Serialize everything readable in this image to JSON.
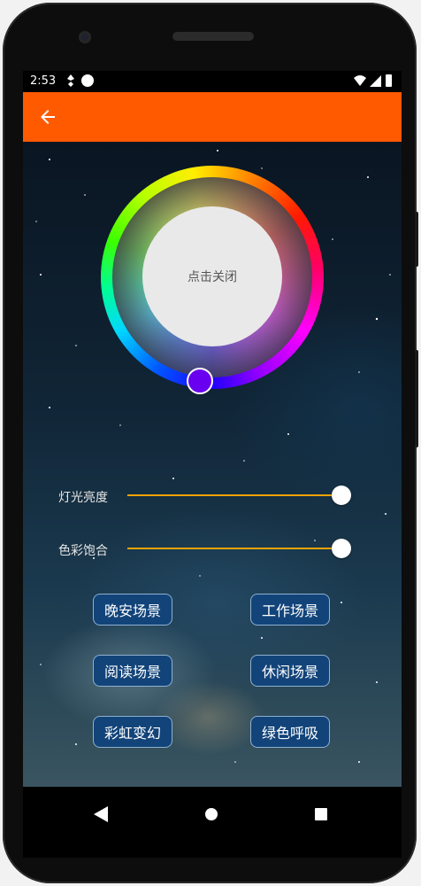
{
  "status_bar": {
    "time": "2:53",
    "icons": [
      "notification-icon",
      "app-notification-icon",
      "wifi-icon",
      "signal-icon",
      "battery-icon"
    ]
  },
  "app_bar": {
    "color": "#ff5a00",
    "back_icon": "arrow-left-icon"
  },
  "color_wheel": {
    "center_label": "点击关闭",
    "selected_color": "#6a00f0"
  },
  "sliders": [
    {
      "label": "灯光亮度",
      "value": 1.0,
      "color": "#f2a400"
    },
    {
      "label": "色彩饱合",
      "value": 1.0,
      "color": "#f2a400"
    }
  ],
  "scenes": [
    {
      "label": "晚安场景"
    },
    {
      "label": "工作场景"
    },
    {
      "label": "阅读场景"
    },
    {
      "label": "休闲场景"
    },
    {
      "label": "彩虹变幻"
    },
    {
      "label": "绿色呼吸"
    }
  ],
  "nav_bar": {
    "icons": [
      "back-icon",
      "home-icon",
      "recents-icon"
    ]
  }
}
